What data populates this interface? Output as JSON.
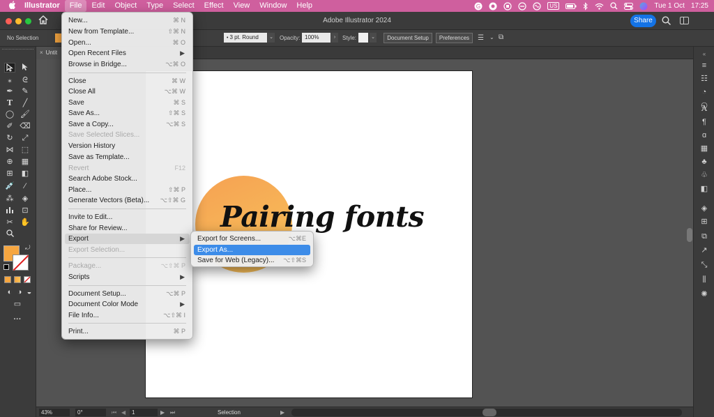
{
  "menubar": {
    "app": "Illustrator",
    "items": [
      "File",
      "Edit",
      "Object",
      "Type",
      "Select",
      "Effect",
      "View",
      "Window",
      "Help"
    ],
    "status": {
      "input_source": "US",
      "date": "Tue 1 Oct",
      "time": "17:25"
    }
  },
  "titlebar": {
    "title": "Adobe Illustrator 2024",
    "share_label": "Share"
  },
  "control_bar": {
    "selection": "No Selection",
    "stroke_profile": "3 pt. Round",
    "opacity_label": "Opacity:",
    "opacity_value": "100%",
    "style_label": "Style:",
    "document_setup": "Document Setup",
    "preferences": "Preferences",
    "fill_color": "#f6a640"
  },
  "document_tab": {
    "label": "Untit"
  },
  "artboard": {
    "text": "Pairing fonts",
    "circle_colors": [
      "#f5a153",
      "#f9c45a"
    ]
  },
  "status_bar": {
    "zoom": "43%",
    "rotation": "0°",
    "artboard_number": "1",
    "tool": "Selection"
  },
  "file_menu": {
    "items": [
      {
        "label": "New...",
        "shortcut": "⌘ N"
      },
      {
        "label": "New from Template...",
        "shortcut": "⇧⌘ N"
      },
      {
        "label": "Open...",
        "shortcut": "⌘ O"
      },
      {
        "label": "Open Recent Files",
        "submenu": true
      },
      {
        "label": "Browse in Bridge...",
        "shortcut": "⌥⌘ O"
      },
      {
        "label": "Close",
        "shortcut": "⌘ W"
      },
      {
        "label": "Close All",
        "shortcut": "⌥⌘ W"
      },
      {
        "label": "Save",
        "shortcut": "⌘ S"
      },
      {
        "label": "Save As...",
        "shortcut": "⇧⌘ S"
      },
      {
        "label": "Save a Copy...",
        "shortcut": "⌥⌘ S"
      },
      {
        "label": "Save Selected Slices...",
        "disabled": true
      },
      {
        "label": "Version History"
      },
      {
        "label": "Save as Template..."
      },
      {
        "label": "Revert",
        "shortcut": "F12",
        "disabled": true
      },
      {
        "label": "Search Adobe Stock..."
      },
      {
        "label": "Place...",
        "shortcut": "⇧⌘ P"
      },
      {
        "label": "Generate Vectors (Beta)...",
        "shortcut": "⌥⇧⌘ G"
      },
      {
        "label": "Invite to Edit..."
      },
      {
        "label": "Share for Review..."
      },
      {
        "label": "Export",
        "submenu": true,
        "highlighted": true
      },
      {
        "label": "Export Selection...",
        "disabled": true
      },
      {
        "label": "Package...",
        "shortcut": "⌥⇧⌘ P",
        "disabled": true
      },
      {
        "label": "Scripts",
        "submenu": true
      },
      {
        "label": "Document Setup...",
        "shortcut": "⌥⌘ P"
      },
      {
        "label": "Document Color Mode",
        "submenu": true
      },
      {
        "label": "File Info...",
        "shortcut": "⌥⇧⌘ I"
      },
      {
        "label": "Print...",
        "shortcut": "⌘ P"
      }
    ]
  },
  "export_submenu": {
    "items": [
      {
        "label": "Export for Screens...",
        "shortcut": "⌥⌘E"
      },
      {
        "label": "Export As...",
        "selected": true
      },
      {
        "label": "Save for Web (Legacy)...",
        "shortcut": "⌥⇧⌘S"
      }
    ]
  }
}
